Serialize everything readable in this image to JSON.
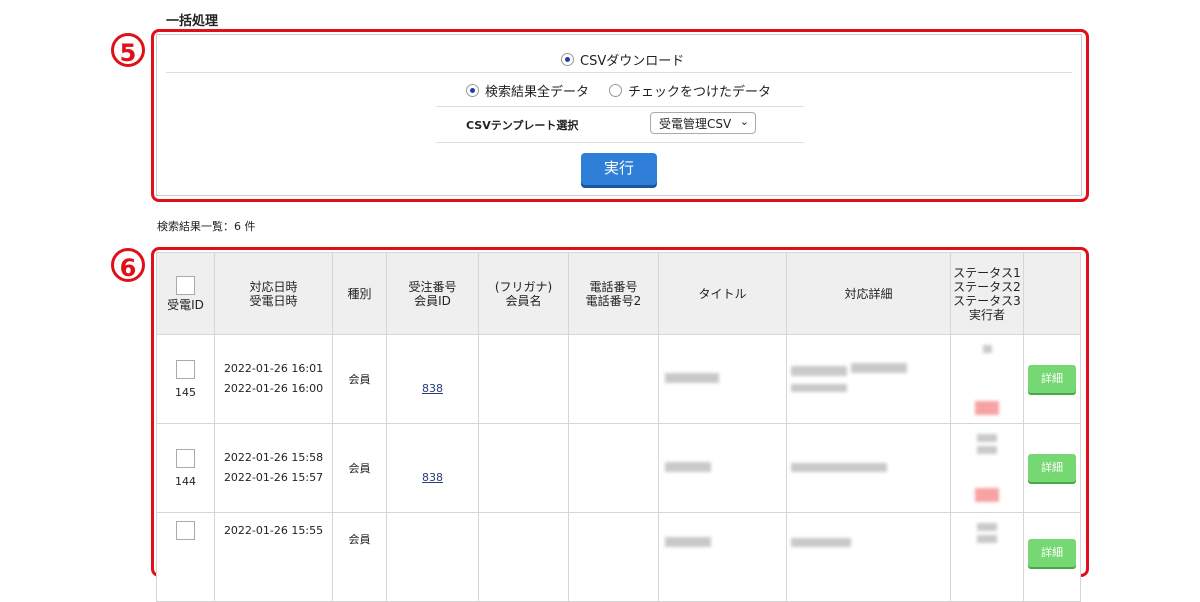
{
  "bulk": {
    "title": "一括処理",
    "csv_download": "CSVダウンロード",
    "scope_all": "検索結果全データ",
    "scope_checked": "チェックをつけたデータ",
    "template_label": "CSVテンプレート選択",
    "template_selected": "受電管理CSV",
    "execute": "実行"
  },
  "callouts": {
    "five": "5",
    "six": "6"
  },
  "results": {
    "count_text": "検索結果一覧：6 件",
    "headers": {
      "id": "受電ID",
      "datetime_1": "対応日時",
      "datetime_2": "受電日時",
      "type": "種別",
      "order_1": "受注番号",
      "order_2": "会員ID",
      "name_1": "(フリガナ)",
      "name_2": "会員名",
      "phone_1": "電話番号",
      "phone_2": "電話番号2",
      "title": "タイトル",
      "detail": "対応詳細",
      "status_1": "ステータス1",
      "status_2": "ステータス2",
      "status_3": "ステータス3",
      "status_4": "実行者"
    },
    "rows": [
      {
        "id": "145",
        "dt1": "2022-01-26 16:01",
        "dt2": "2022-01-26 16:00",
        "type": "会員",
        "member_id": "838",
        "detail_button": "詳細"
      },
      {
        "id": "144",
        "dt1": "2022-01-26 15:58",
        "dt2": "2022-01-26 15:57",
        "type": "会員",
        "member_id": "838",
        "detail_button": "詳細"
      },
      {
        "id": "",
        "dt1": "2022-01-26 15:55",
        "dt2": "",
        "type": "会員",
        "member_id": "",
        "detail_button": "詳細"
      }
    ]
  },
  "colors": {
    "callout_red": "#e0101a",
    "exec_blue": "#2f7fd9",
    "detail_green": "#76d872"
  }
}
